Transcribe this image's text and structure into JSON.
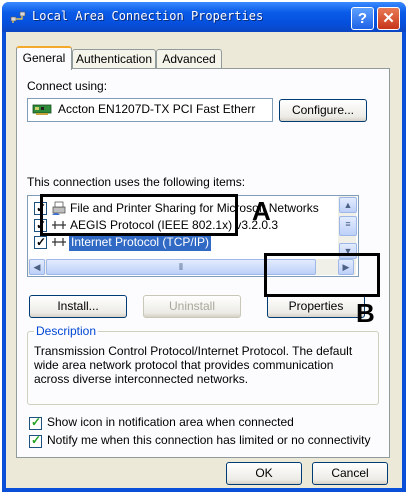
{
  "window": {
    "title": "Local Area Connection Properties",
    "help_glyph": "?",
    "close_glyph": "✕"
  },
  "tabs": [
    {
      "label": "General"
    },
    {
      "label": "Authentication"
    },
    {
      "label": "Advanced"
    }
  ],
  "connect_using": {
    "label": "Connect using:",
    "adapter": "Accton EN1207D-TX PCI Fast Etherr",
    "configure_button": "Configure..."
  },
  "items_section": {
    "label": "This connection uses the following items:",
    "items": [
      {
        "label": "File and Printer Sharing for Microsoft Networks",
        "checked": true
      },
      {
        "label": "AEGIS Protocol (IEEE 802.1x) v3.2.0.3",
        "checked": true
      },
      {
        "label": "Internet Protocol (TCP/IP)",
        "checked": true,
        "selected": true
      }
    ]
  },
  "buttons": {
    "install": "Install...",
    "uninstall": "Uninstall",
    "properties": "Properties",
    "ok": "OK",
    "cancel": "Cancel"
  },
  "description": {
    "legend": "Description",
    "text": "Transmission Control Protocol/Internet Protocol. The default wide area network protocol that provides communication across diverse interconnected networks."
  },
  "options": {
    "show_icon": "Show icon in notification area when connected",
    "notify": "Notify me when this connection has limited or no connectivity"
  },
  "annotations": {
    "a": "A",
    "b": "B"
  },
  "colors": {
    "title_bar": "#0a5be8",
    "dialog_bg": "#ece9d8",
    "selection": "#316ac5",
    "group_legend": "#0046d5"
  }
}
